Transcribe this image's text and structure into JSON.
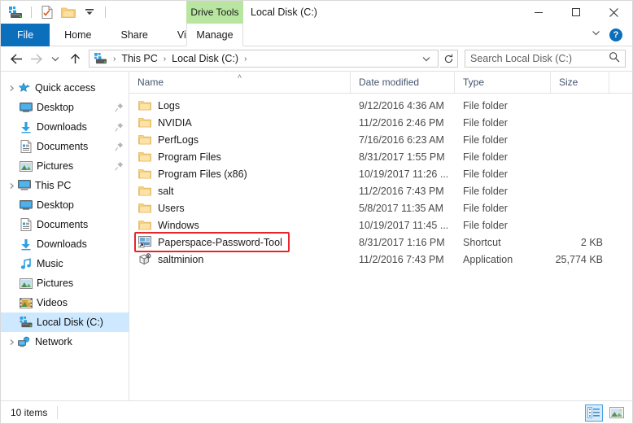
{
  "window": {
    "title": "Local Disk (C:)",
    "contextual_tab_group": "Drive Tools",
    "quick_access": [
      {
        "name": "drive-icon",
        "label": "Local Disk"
      },
      {
        "name": "properties-icon",
        "label": "Properties"
      },
      {
        "name": "new-folder-icon",
        "label": "New folder"
      },
      {
        "name": "customize-chevron-icon",
        "label": "Customize Quick Access Toolbar"
      }
    ],
    "controls": {
      "minimize": "Minimize",
      "maximize": "Maximize",
      "close": "Close"
    }
  },
  "ribbon": {
    "tabs": [
      {
        "label": "File",
        "active": true
      },
      {
        "label": "Home",
        "active": false
      },
      {
        "label": "Share",
        "active": false
      },
      {
        "label": "View",
        "active": false
      }
    ],
    "contextual_tab": {
      "label": "Manage"
    },
    "collapse_label": "Minimize the Ribbon",
    "help_label": "?"
  },
  "address": {
    "back": "Back",
    "forward": "Forward",
    "recent": "Recent locations",
    "up": "Up",
    "breadcrumbs": [
      {
        "label": "This PC"
      },
      {
        "label": "Local Disk (C:)"
      }
    ],
    "dropdown": "Previous locations",
    "refresh": "Refresh",
    "separator": "›"
  },
  "search": {
    "placeholder": "Search Local Disk (C:)",
    "icon": "search-icon"
  },
  "sidebar": {
    "items": [
      {
        "label": "Quick access",
        "icon": "star-icon",
        "level": 0,
        "expandable": true,
        "pinned": false,
        "selected": false
      },
      {
        "label": "Desktop",
        "icon": "desktop-icon",
        "level": 1,
        "expandable": false,
        "pinned": true,
        "selected": false
      },
      {
        "label": "Downloads",
        "icon": "downloads-icon",
        "level": 1,
        "expandable": false,
        "pinned": true,
        "selected": false
      },
      {
        "label": "Documents",
        "icon": "documents-icon",
        "level": 1,
        "expandable": false,
        "pinned": true,
        "selected": false
      },
      {
        "label": "Pictures",
        "icon": "pictures-icon",
        "level": 1,
        "expandable": false,
        "pinned": true,
        "selected": false
      },
      {
        "label": "This PC",
        "icon": "this-pc-icon",
        "level": 0,
        "expandable": true,
        "pinned": false,
        "selected": false
      },
      {
        "label": "Desktop",
        "icon": "desktop-icon",
        "level": 1,
        "expandable": false,
        "pinned": false,
        "selected": false
      },
      {
        "label": "Documents",
        "icon": "documents-icon",
        "level": 1,
        "expandable": false,
        "pinned": false,
        "selected": false
      },
      {
        "label": "Downloads",
        "icon": "downloads-icon",
        "level": 1,
        "expandable": false,
        "pinned": false,
        "selected": false
      },
      {
        "label": "Music",
        "icon": "music-icon",
        "level": 1,
        "expandable": false,
        "pinned": false,
        "selected": false
      },
      {
        "label": "Pictures",
        "icon": "pictures-icon",
        "level": 1,
        "expandable": false,
        "pinned": false,
        "selected": false
      },
      {
        "label": "Videos",
        "icon": "videos-icon",
        "level": 1,
        "expandable": false,
        "pinned": false,
        "selected": false
      },
      {
        "label": "Local Disk (C:)",
        "icon": "drive-icon",
        "level": 1,
        "expandable": false,
        "pinned": false,
        "selected": true
      },
      {
        "label": "Network",
        "icon": "network-icon",
        "level": 0,
        "expandable": true,
        "pinned": false,
        "selected": false
      }
    ]
  },
  "filelist": {
    "columns": [
      {
        "label": "Name",
        "sorted": true,
        "sort_direction": "asc"
      },
      {
        "label": "Date modified",
        "sorted": false
      },
      {
        "label": "Type",
        "sorted": false
      },
      {
        "label": "Size",
        "sorted": false
      }
    ],
    "sort_caret": "˄",
    "rows": [
      {
        "name": "Logs",
        "date": "9/12/2016 4:36 AM",
        "type": "File folder",
        "size": "",
        "icon": "folder-icon",
        "highlighted": false
      },
      {
        "name": "NVIDIA",
        "date": "11/2/2016 2:46 PM",
        "type": "File folder",
        "size": "",
        "icon": "folder-icon",
        "highlighted": false
      },
      {
        "name": "PerfLogs",
        "date": "7/16/2016 6:23 AM",
        "type": "File folder",
        "size": "",
        "icon": "folder-icon",
        "highlighted": false
      },
      {
        "name": "Program Files",
        "date": "8/31/2017 1:55 PM",
        "type": "File folder",
        "size": "",
        "icon": "folder-icon",
        "highlighted": false
      },
      {
        "name": "Program Files (x86)",
        "date": "10/19/2017 11:26 ...",
        "type": "File folder",
        "size": "",
        "icon": "folder-icon",
        "highlighted": false
      },
      {
        "name": "salt",
        "date": "11/2/2016 7:43 PM",
        "type": "File folder",
        "size": "",
        "icon": "folder-icon",
        "highlighted": false
      },
      {
        "name": "Users",
        "date": "5/8/2017 11:35 AM",
        "type": "File folder",
        "size": "",
        "icon": "folder-icon",
        "highlighted": false
      },
      {
        "name": "Windows",
        "date": "10/19/2017 11:45 ...",
        "type": "File folder",
        "size": "",
        "icon": "folder-icon",
        "highlighted": false
      },
      {
        "name": "Paperspace-Password-Tool",
        "date": "8/31/2017 1:16 PM",
        "type": "Shortcut",
        "size": "2 KB",
        "icon": "shortcut-icon",
        "highlighted": true
      },
      {
        "name": "saltminion",
        "date": "11/2/2016 7:43 PM",
        "type": "Application",
        "size": "25,774 KB",
        "icon": "application-icon",
        "highlighted": false
      }
    ]
  },
  "statusbar": {
    "item_count": "10 items",
    "views": [
      {
        "name": "details-view",
        "label": "Details",
        "active": true
      },
      {
        "name": "large-icons-view",
        "label": "Large icons",
        "active": false
      }
    ]
  },
  "colors": {
    "accent": "#0c6fbb",
    "contextual_green": "#b8e6a0",
    "selection": "#cde8ff",
    "highlight_red": "#e8252a",
    "folder_yellow": "#f7d27f"
  }
}
